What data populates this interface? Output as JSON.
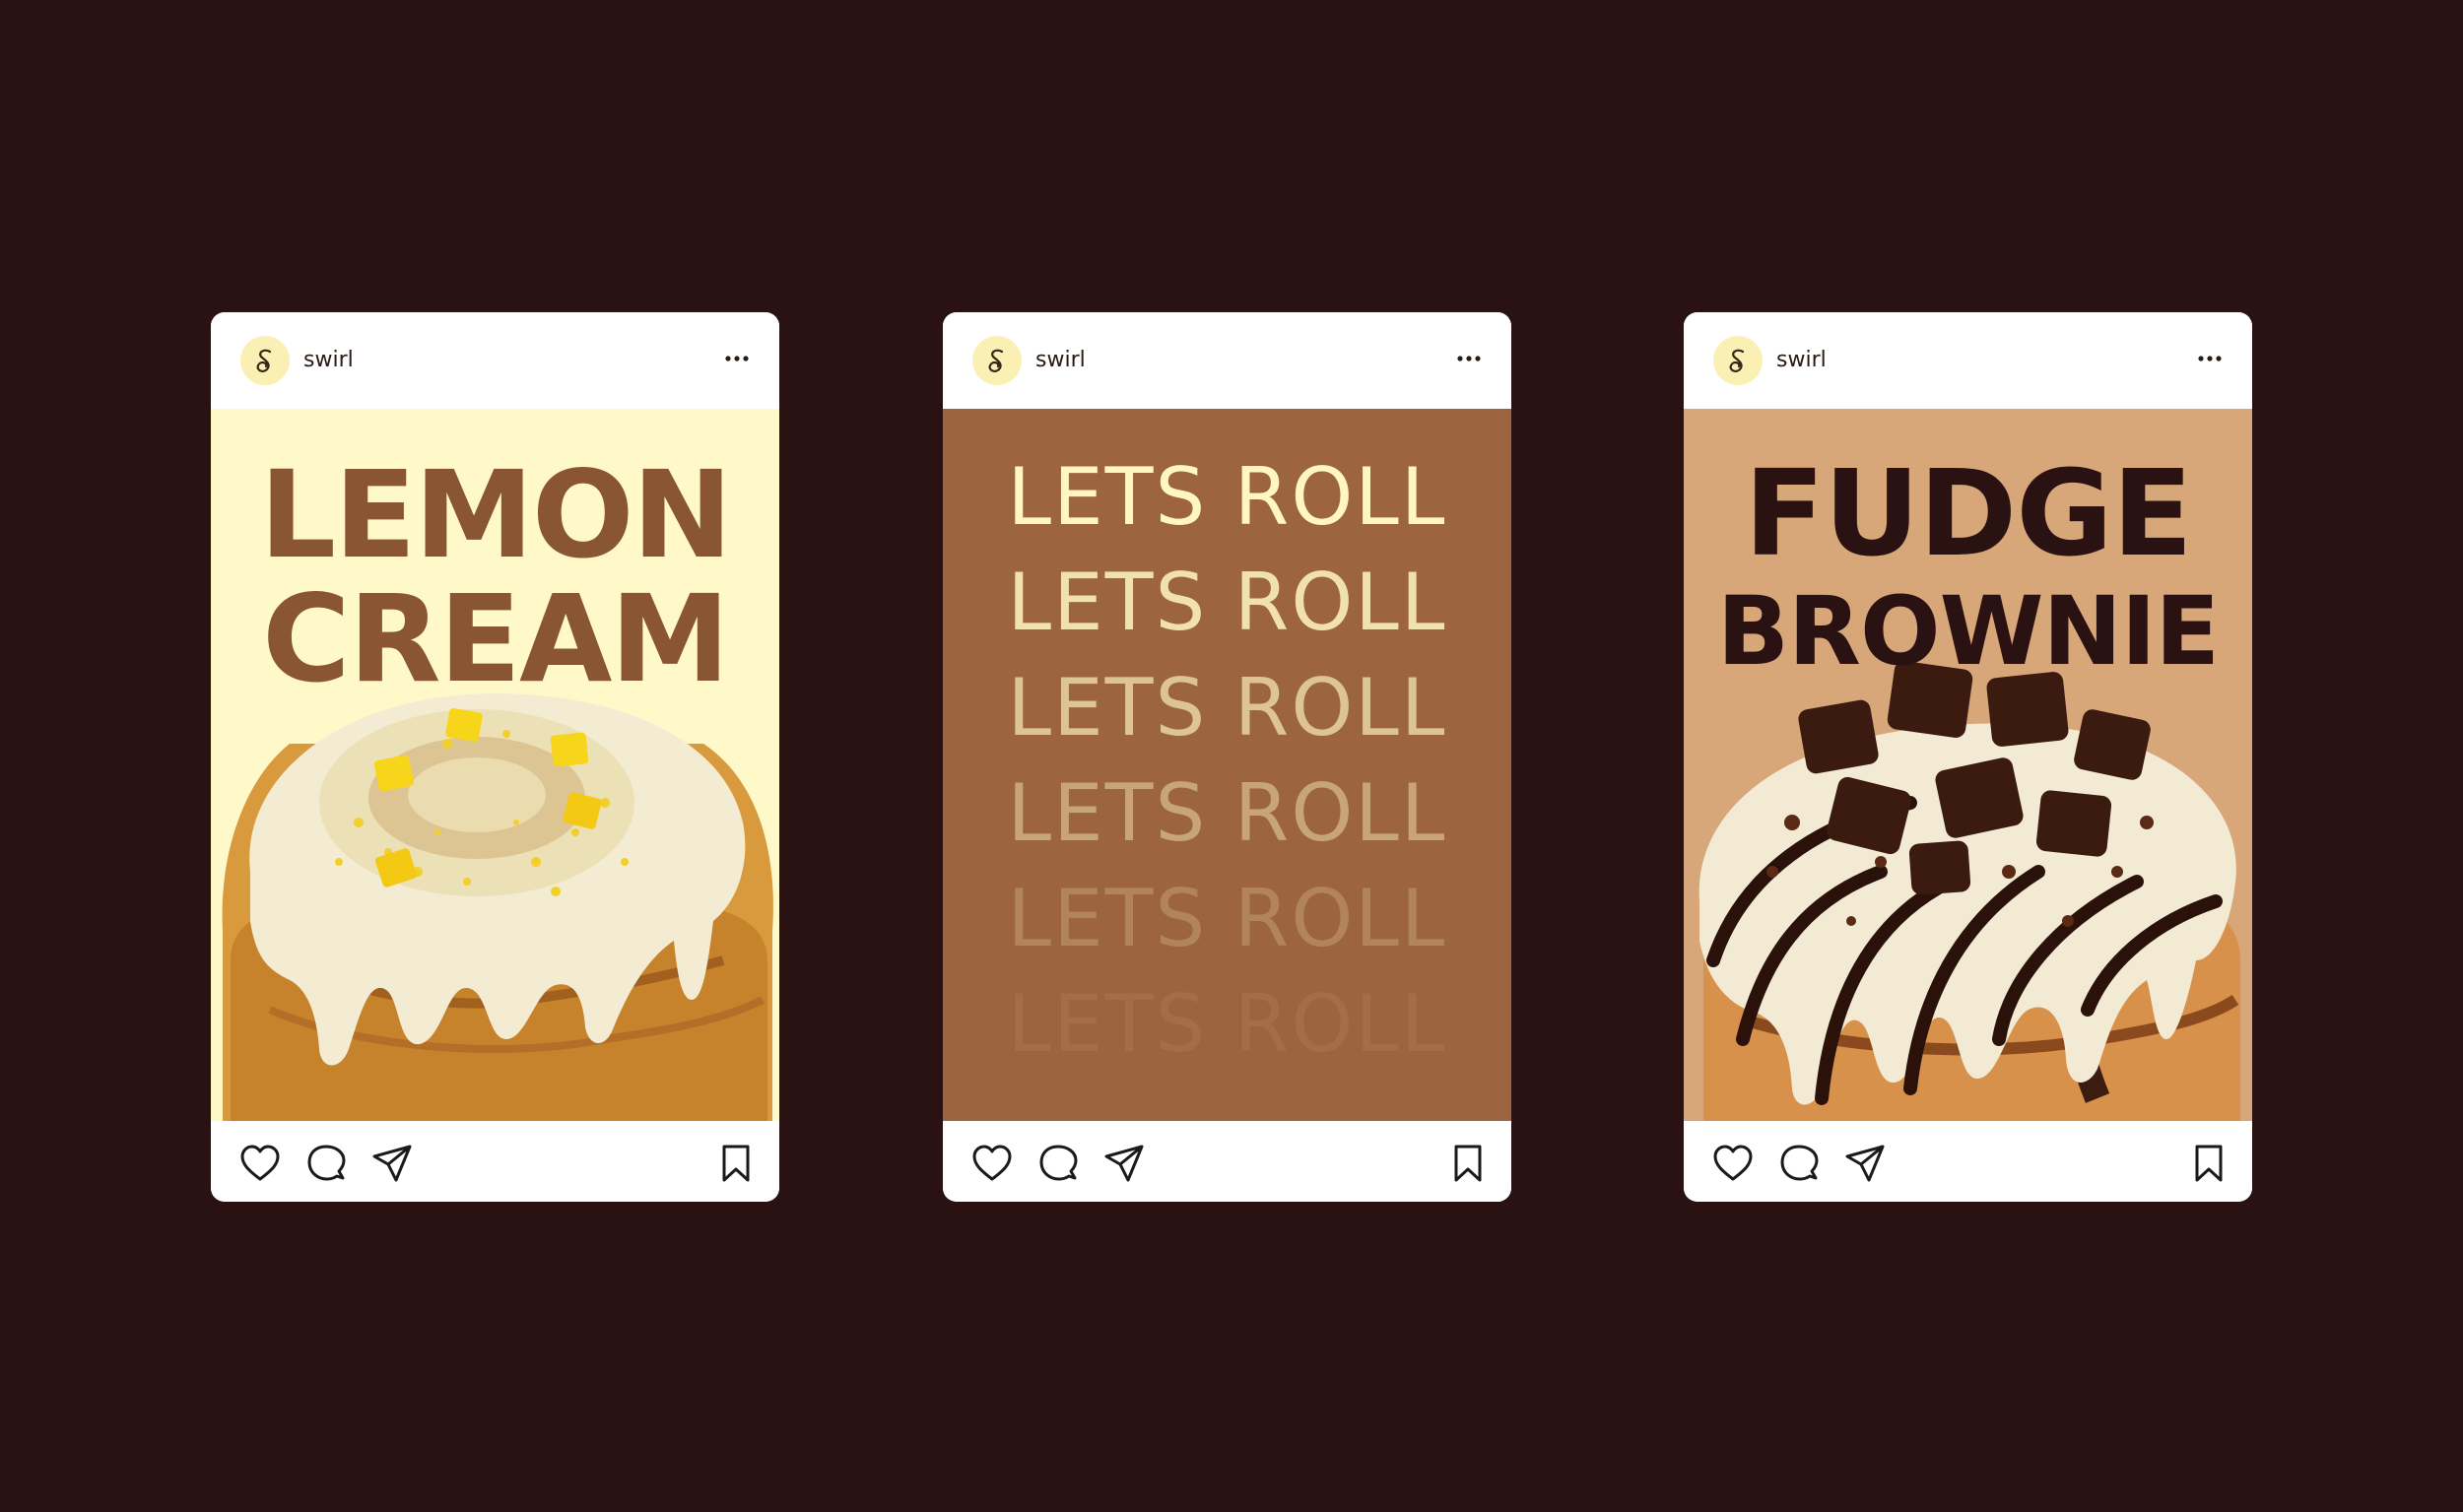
{
  "background_color": "#2b1212",
  "posts": [
    {
      "username": "swirl",
      "headline_line1": "LEMON",
      "headline_line2": "CREAM",
      "media_color": "#fff8c8",
      "text_color": "#8a5533",
      "image": "lemon-cream-cinnamon-roll"
    },
    {
      "username": "swirl",
      "repeat_lines": [
        "LETS ROLL",
        "LETS ROLL",
        "LETS ROLL",
        "LETS ROLL",
        "LETS ROLL",
        "LETS ROLL"
      ],
      "media_color": "#9c643f",
      "text_color": "#fff6c4"
    },
    {
      "username": "swirl",
      "headline_line1": "FUDGE",
      "headline_line2": "BROWNIE",
      "media_color": "#d7a679",
      "text_color": "#2b1212",
      "image": "fudge-brownie-cinnamon-roll"
    }
  ],
  "icons": {
    "avatar": "swirl-logo-icon",
    "more": "more-options-icon",
    "like": "heart-icon",
    "comment": "comment-bubble-icon",
    "share": "paper-plane-icon",
    "save": "bookmark-icon"
  }
}
